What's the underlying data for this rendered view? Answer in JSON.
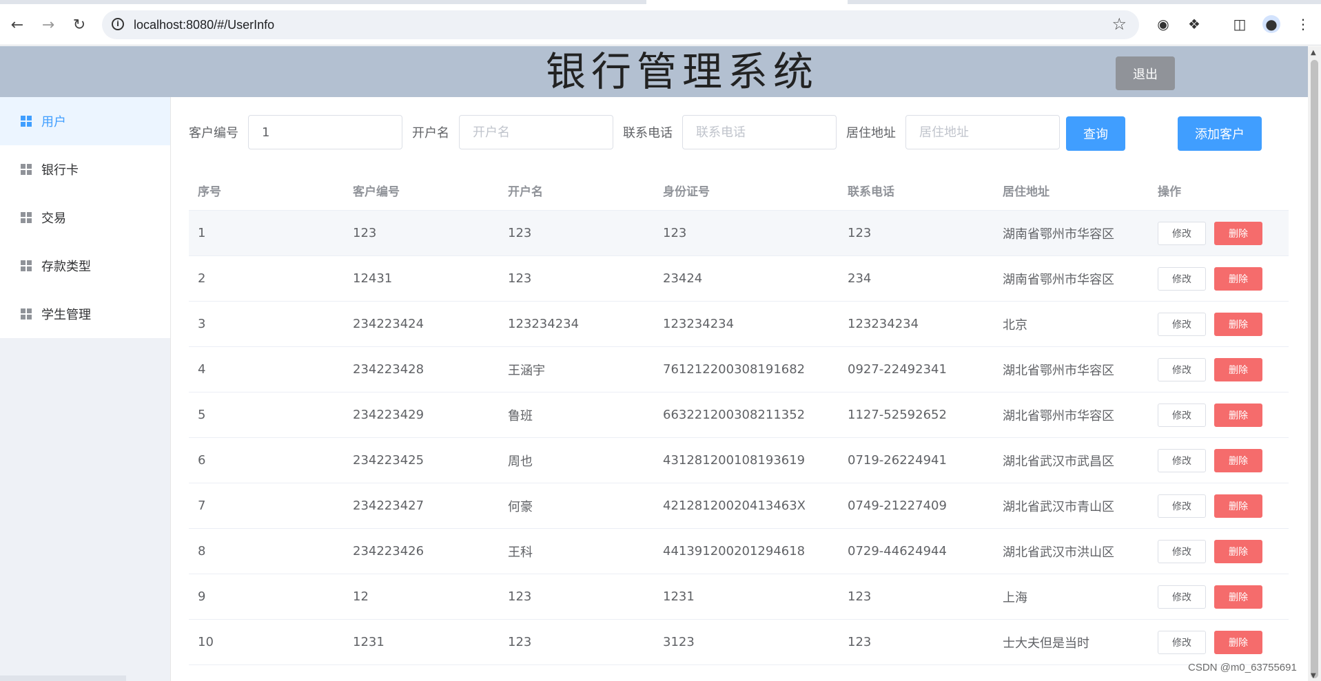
{
  "browser": {
    "url": "localhost:8080/#/UserInfo",
    "icons": [
      "back-icon",
      "forward-icon",
      "reload-icon",
      "site-info-icon",
      "bookmark-star-icon",
      "extension-icon",
      "puzzle-icon",
      "side-panel-icon",
      "profile-icon",
      "more-icon"
    ]
  },
  "header": {
    "title": "银行管理系统",
    "logout_label": "退出"
  },
  "sidebar": {
    "items": [
      {
        "label": "用户",
        "active": true
      },
      {
        "label": "银行卡"
      },
      {
        "label": "交易"
      },
      {
        "label": "存款类型"
      },
      {
        "label": "学生管理"
      }
    ]
  },
  "filters": {
    "customer_no_label": "客户编号",
    "customer_no_value": "1",
    "account_name_label": "开户名",
    "account_name_placeholder": "开户名",
    "phone_label": "联系电话",
    "phone_placeholder": "联系电话",
    "address_label": "居住地址",
    "address_placeholder": "居住地址",
    "query_label": "查询",
    "add_label": "添加客户"
  },
  "table": {
    "columns": [
      "序号",
      "客户编号",
      "开户名",
      "身份证号",
      "联系电话",
      "居住地址",
      "操作"
    ],
    "edit_label": "修改",
    "delete_label": "删除",
    "rows": [
      [
        "1",
        "123",
        "123",
        "123",
        "123",
        "湖南省鄂州市华容区"
      ],
      [
        "2",
        "12431",
        "123",
        "23424",
        "234",
        "湖南省鄂州市华容区"
      ],
      [
        "3",
        "234223424",
        "123234234",
        "123234234",
        "123234234",
        "北京"
      ],
      [
        "4",
        "234223428",
        "王涵宇",
        "761212200308191682",
        "0927-22492341",
        "湖北省鄂州市华容区"
      ],
      [
        "5",
        "234223429",
        "鲁班",
        "663221200308211352",
        "1127-52592652",
        "湖北省鄂州市华容区"
      ],
      [
        "6",
        "234223425",
        "周也",
        "431281200108193619",
        "0719-26224941",
        "湖北省武汉市武昌区"
      ],
      [
        "7",
        "234223427",
        "何豪",
        "42128120020413463X",
        "0749-21227409",
        "湖北省武汉市青山区"
      ],
      [
        "8",
        "234223426",
        "王科",
        "441391200201294618",
        "0729-44624944",
        "湖北省武汉市洪山区"
      ],
      [
        "9",
        "12",
        "123",
        "1231",
        "123",
        "上海"
      ],
      [
        "10",
        "1231",
        "123",
        "3123",
        "123",
        "士大夫但是当时"
      ]
    ]
  },
  "watermark": "CSDN @m0_63755691",
  "colors": {
    "header_bg": "#b3c0d1",
    "primary": "#409eff",
    "danger": "#f56c6c",
    "logout": "#909399",
    "sidebar_active_bg": "#ecf5ff"
  }
}
